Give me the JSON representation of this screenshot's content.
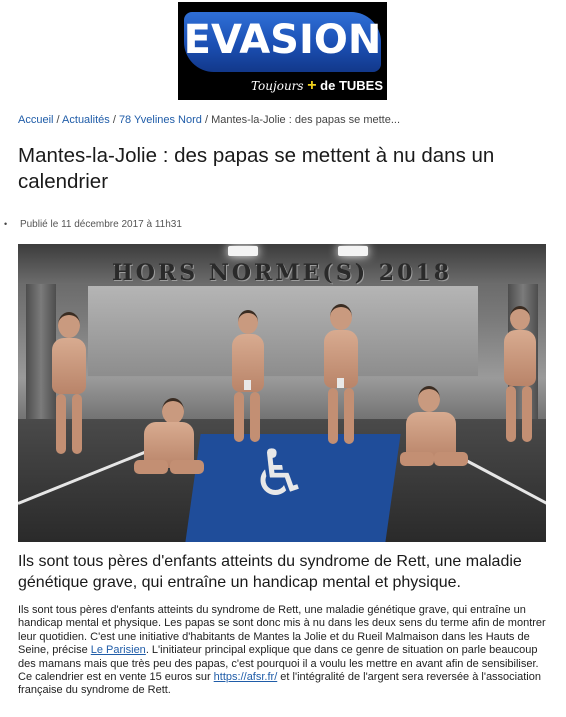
{
  "logo": {
    "word": "EVASION",
    "tagline_a": "Toujours",
    "tagline_plus": "+",
    "tagline_b": "de TUBES"
  },
  "breadcrumb": {
    "items": [
      "Accueil",
      "Actualités",
      "78 Yvelines Nord"
    ],
    "separator": "/",
    "current": "Mantes-la-Jolie : des papas se mette..."
  },
  "article": {
    "title": "Mantes-la-Jolie : des papas se mettent à nu dans un calendrier",
    "bullet": "•",
    "published": "Publié le 11 décembre 2017 à 11h31",
    "photo": {
      "banner": "HORS NORME(S)   2018",
      "symbol": "♿"
    },
    "lead": "Ils sont tous pères d'enfants atteints du syndrome de Rett, une maladie génétique grave, qui entraîne un handicap mental et physique.",
    "body": {
      "part1": "Ils sont tous pères d'enfants atteints du syndrome de Rett, une maladie génétique grave, qui entraîne un handicap mental et physique. Les papas se sont donc mis à nu dans les deux sens du terme afin de montrer leur quotidien. C'est une initiative d'habitants de Mantes la Jolie et du Rueil Malmaison dans les Hauts de Seine, précise ",
      "link1": "Le Parisien",
      "part2": ". L'initiateur principal explique que dans ce genre de situation on parle beaucoup des mamans mais que très peu des papas, c'est pourquoi il a voulu les mettre en avant afin de sensibiliser. Ce calendrier est en vente 15 euros sur ",
      "link2": "https://afsr.fr/",
      "part3": " et l'intégralité de l'argent sera reversée à l'association française du syndrome de Rett."
    }
  }
}
